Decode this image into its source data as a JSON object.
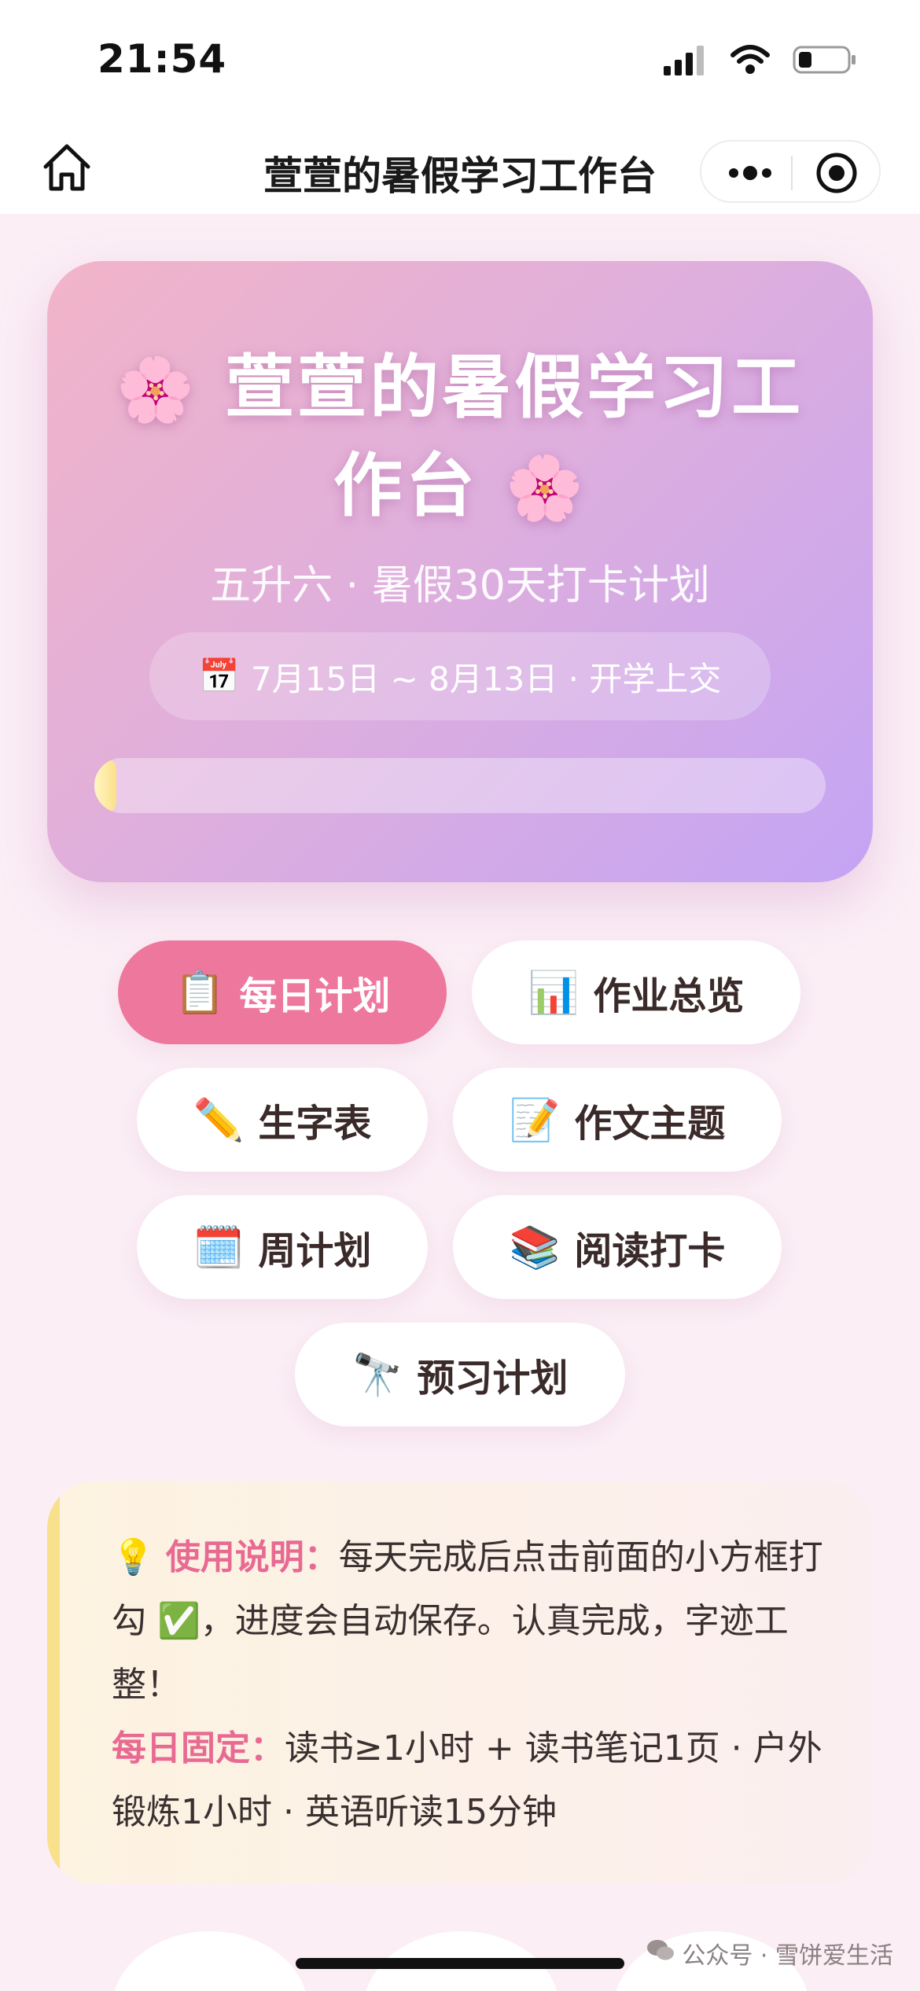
{
  "status_bar": {
    "time": "21:54",
    "icons": [
      "signal-icon",
      "wifi-icon",
      "battery-icon"
    ]
  },
  "nav": {
    "title": "萱萱的暑假学习工作台",
    "icons": [
      "home-icon",
      "more-icon",
      "close-mini-program-icon"
    ]
  },
  "hero": {
    "title": "萱萱的暑假学习工作台",
    "flower_emoji": "🌸",
    "subtitle": "五升六 · 暑假30天打卡计划",
    "date_emoji": "📅",
    "date_range": "7月15日 ~ 8月13日 · 开学上交",
    "progress_percent": 3
  },
  "tabs": [
    {
      "emoji": "📋",
      "label": "每日计划",
      "active": true
    },
    {
      "emoji": "📊",
      "label": "作业总览",
      "active": false
    },
    {
      "emoji": "✏️",
      "label": "生字表",
      "active": false
    },
    {
      "emoji": "📝",
      "label": "作文主题",
      "active": false
    },
    {
      "emoji": "🗓️",
      "label": "周计划",
      "active": false
    },
    {
      "emoji": "📚",
      "label": "阅读打卡",
      "active": false
    },
    {
      "emoji": "🔭",
      "label": "预习计划",
      "active": false
    }
  ],
  "tip": {
    "bulb_emoji": "💡",
    "usage_label": "使用说明：",
    "usage_text_before": "每天完成后点击前面的小方框打勾",
    "check_emoji": "✅",
    "usage_text_after": "，进度会自动保存。认真完成，字迹工整！",
    "daily_label": "每日固定：",
    "daily_text": "读书≥1小时 + 读书笔记1页 · 户外锻炼1小时 · 英语听读15分钟"
  },
  "watermark": {
    "text": "公众号 · 雪饼爱生活"
  },
  "colors": {
    "accent_pink": "#ee779e",
    "tip_label": "#e86a92",
    "hero_gradient_start": "#f2b4c8",
    "hero_gradient_end": "#c4a4f4",
    "page_bg": "#fbeef5"
  }
}
